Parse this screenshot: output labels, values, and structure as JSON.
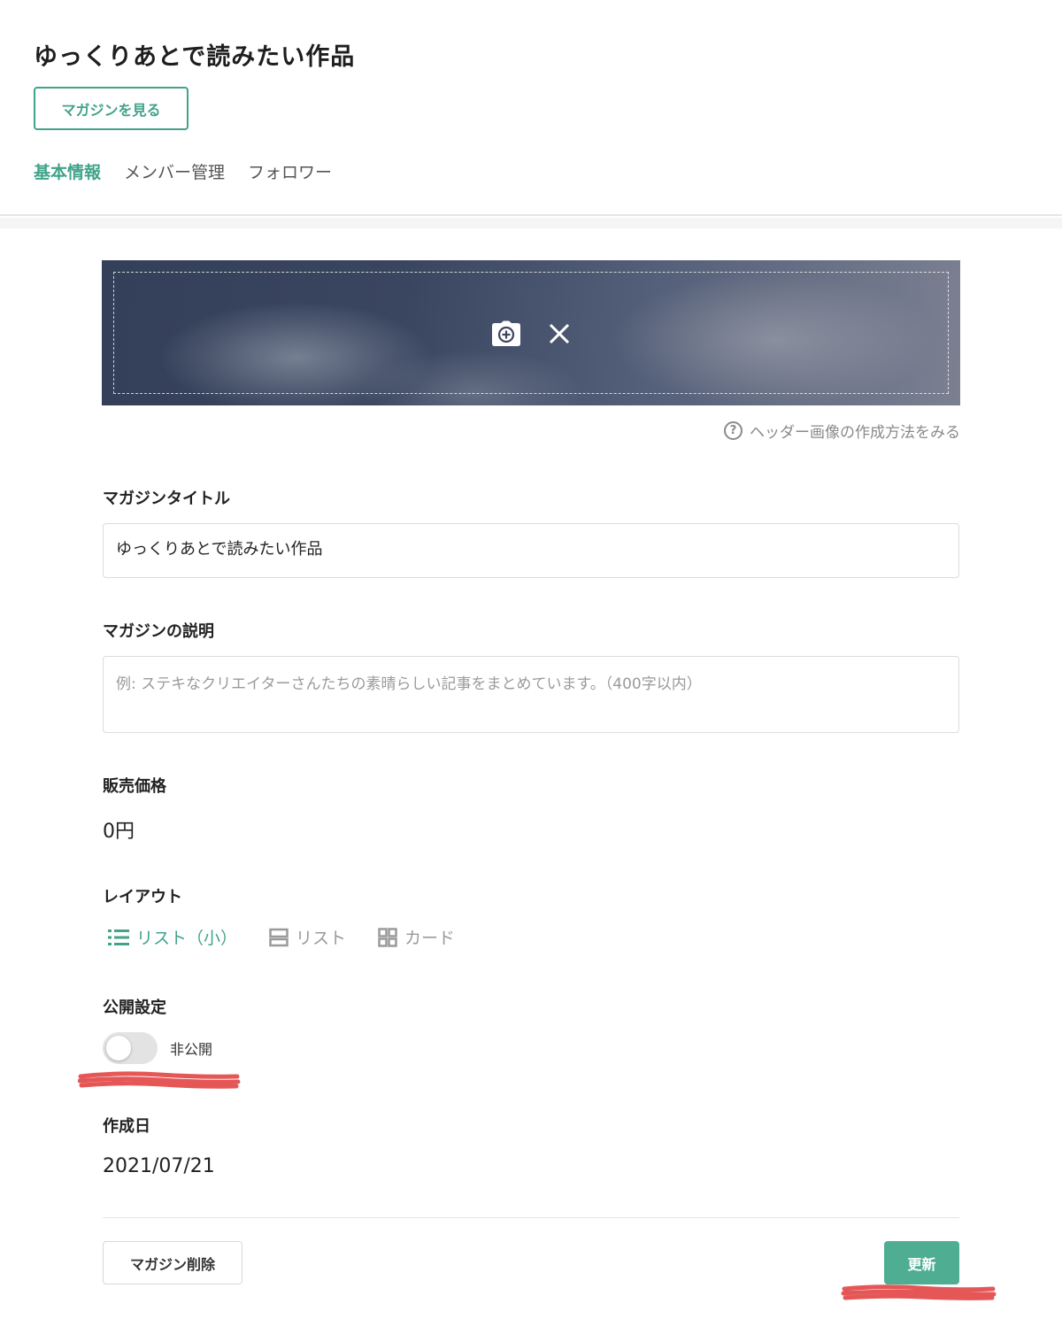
{
  "header": {
    "title": "ゆっくりあとで読みたい作品",
    "view_magazine_label": "マガジンを見る",
    "tabs": [
      {
        "label": "基本情報",
        "active": true
      },
      {
        "label": "メンバー管理",
        "active": false
      },
      {
        "label": "フォロワー",
        "active": false
      }
    ]
  },
  "banner": {
    "icons": [
      "camera-add-icon",
      "close-icon"
    ],
    "help_text": "ヘッダー画像の作成方法をみる",
    "help_icon": "question-circle-icon"
  },
  "form": {
    "title_label": "マガジンタイトル",
    "title_value": "ゆっくりあとで読みたい作品",
    "description_label": "マガジンの説明",
    "description_placeholder": "例: ステキなクリエイターさんたちの素晴らしい記事をまとめています。（400字以内）",
    "price_label": "販売価格",
    "price_value": "0円",
    "layout_label": "レイアウト",
    "layout_options": [
      {
        "label": "リスト（小）",
        "icon": "list-small-icon",
        "active": true
      },
      {
        "label": "リスト",
        "icon": "list-icon",
        "active": false
      },
      {
        "label": "カード",
        "icon": "grid-icon",
        "active": false
      }
    ],
    "visibility_label": "公開設定",
    "visibility_on": false,
    "visibility_state_text": "非公開",
    "created_label": "作成日",
    "created_value": "2021/07/21"
  },
  "footer": {
    "delete_label": "マガジン削除",
    "update_label": "更新"
  },
  "colors": {
    "accent": "#41a38a",
    "update_button": "#4fae92",
    "annotation_scribble": "#e03a3a"
  }
}
